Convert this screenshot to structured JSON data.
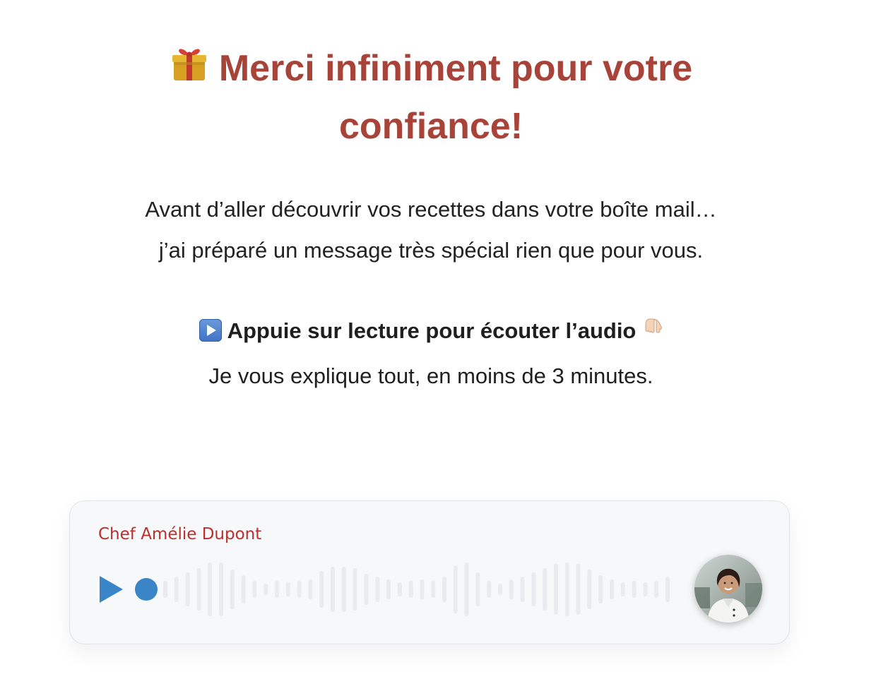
{
  "hero": {
    "icon": "gift-icon",
    "title": "Merci infiniment pour votre confiance!"
  },
  "intro": {
    "line1": "Avant d’aller découvrir vos recettes dans votre boîte mail…",
    "line2": "j’ai préparé un message très spécial rien que pour vous."
  },
  "cta": {
    "icon": "play-button-icon",
    "heading": "Appuie sur lecture pour écouter l’audio",
    "pointer_icon": "pointing-down-icon",
    "subtext": "Je vous explique tout, en moins de 3 minutes."
  },
  "player": {
    "author": "Chef Amélie Dupont",
    "progress": 0,
    "accent": "#3a84c8",
    "author_color": "#b8312c",
    "waveform_levels": [
      0.3,
      0.45,
      0.6,
      0.75,
      0.95,
      0.95,
      0.7,
      0.5,
      0.3,
      0.2,
      0.3,
      0.25,
      0.3,
      0.35,
      0.65,
      0.8,
      0.8,
      0.75,
      0.55,
      0.45,
      0.35,
      0.25,
      0.3,
      0.35,
      0.3,
      0.45,
      0.85,
      0.95,
      0.6,
      0.3,
      0.2,
      0.35,
      0.45,
      0.6,
      0.75,
      0.9,
      0.95,
      0.9,
      0.7,
      0.5,
      0.35,
      0.25,
      0.3,
      0.25,
      0.3,
      0.45,
      0.55
    ]
  },
  "colors": {
    "title": "#a8433a",
    "text": "#222222",
    "background": "#ffffff",
    "card": "#f6f8fa"
  }
}
